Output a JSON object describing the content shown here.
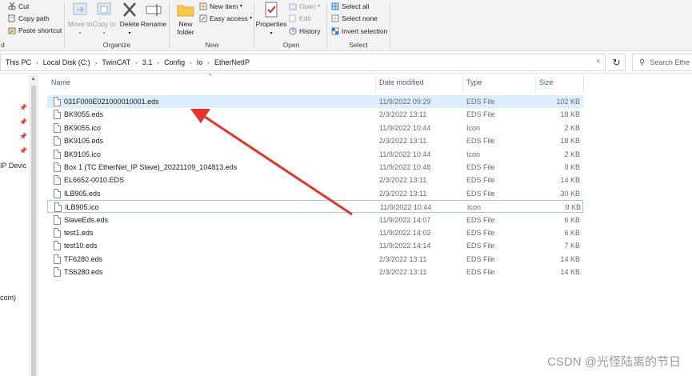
{
  "ribbon": {
    "clipboard": {
      "cut": "Cut",
      "copy_path": "Copy path",
      "paste_shortcut": "Paste shortcut",
      "group_label_partial": "d"
    },
    "organize": {
      "move_to": "Move to",
      "copy_to": "Copy to",
      "delete": "Delete",
      "rename": "Rename",
      "group_label": "Organize"
    },
    "new": {
      "new_folder": "New folder",
      "new_item": "New item",
      "easy_access": "Easy access",
      "group_label": "New"
    },
    "open": {
      "properties": "Properties",
      "open": "Open",
      "edit": "Edit",
      "history": "History",
      "group_label": "Open"
    },
    "select": {
      "select_all": "Select all",
      "select_none": "Select none",
      "invert_selection": "Invert selection",
      "group_label": "Select"
    }
  },
  "address": {
    "crumbs": [
      "This PC",
      "Local Disk (C:)",
      "TwinCAT",
      "3.1",
      "Config",
      "Io",
      "EtherNetIP"
    ],
    "search_placeholder": "Search Ethe"
  },
  "nav": {
    "items": [
      "IP Devic",
      "com)"
    ]
  },
  "columns": {
    "name": "Name",
    "date": "Date modified",
    "type": "Type",
    "size": "Size"
  },
  "files": [
    {
      "name": "031F000E021000010001.eds",
      "date": "11/9/2022 09:29",
      "type": "EDS File",
      "size": "102 KB",
      "state": "selected"
    },
    {
      "name": "BK9055.eds",
      "date": "2/3/2022 13:11",
      "type": "EDS File",
      "size": "18 KB"
    },
    {
      "name": "BK9055.ico",
      "date": "11/9/2022 10:44",
      "type": "Icon",
      "size": "2 KB"
    },
    {
      "name": "BK9105.eds",
      "date": "2/3/2022 13:11",
      "type": "EDS File",
      "size": "18 KB"
    },
    {
      "name": "BK9105.ico",
      "date": "11/9/2022 10:44",
      "type": "Icon",
      "size": "2 KB"
    },
    {
      "name": "Box 1 (TC EtherNet_IP Slave)_20221109_104813.eds",
      "date": "11/9/2022 10:48",
      "type": "EDS File",
      "size": "9 KB"
    },
    {
      "name": "EL6652-0010.EDS",
      "date": "2/3/2022 13:11",
      "type": "EDS File",
      "size": "14 KB"
    },
    {
      "name": "ILB905.eds",
      "date": "2/3/2022 13:11",
      "type": "EDS File",
      "size": "30 KB"
    },
    {
      "name": "ILB905.ico",
      "date": "11/9/2022 10:44",
      "type": "Icon",
      "size": "9 KB",
      "state": "focused"
    },
    {
      "name": "SlaveEds.eds",
      "date": "11/9/2022 14:07",
      "type": "EDS File",
      "size": "6 KB"
    },
    {
      "name": "test1.eds",
      "date": "11/9/2022 14:02",
      "type": "EDS File",
      "size": "6 KB"
    },
    {
      "name": "test10.eds",
      "date": "11/9/2022 14:14",
      "type": "EDS File",
      "size": "7 KB"
    },
    {
      "name": "TF6280.eds",
      "date": "2/3/2022 13:11",
      "type": "EDS File",
      "size": "14 KB"
    },
    {
      "name": "TS6280.eds",
      "date": "2/3/2022 13:11",
      "type": "EDS File",
      "size": "14 KB"
    }
  ],
  "annotation": {
    "arrow_color": "#e8322a"
  },
  "watermark": "CSDN @光怪陆离的节日",
  "colors": {
    "selection": "#dbeefb",
    "header_text": "#4c607a"
  }
}
